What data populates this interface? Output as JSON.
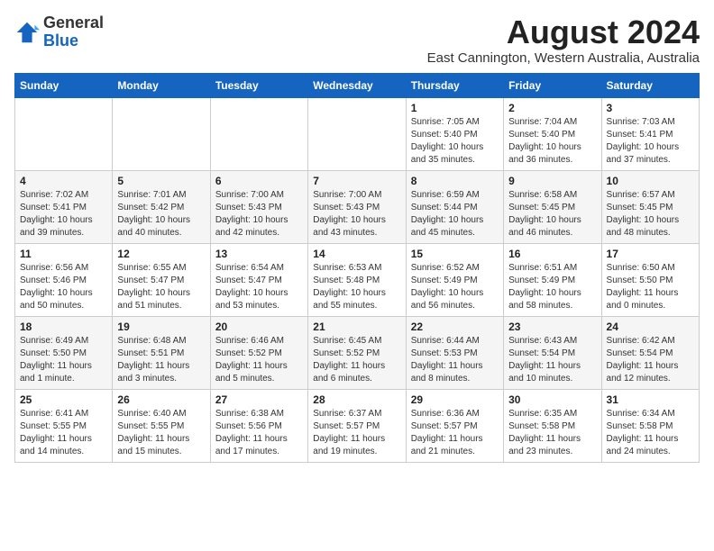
{
  "header": {
    "logo_line1": "General",
    "logo_line2": "Blue",
    "month_title": "August 2024",
    "location": "East Cannington, Western Australia, Australia"
  },
  "days_of_week": [
    "Sunday",
    "Monday",
    "Tuesday",
    "Wednesday",
    "Thursday",
    "Friday",
    "Saturday"
  ],
  "weeks": [
    [
      {
        "day": "",
        "info": ""
      },
      {
        "day": "",
        "info": ""
      },
      {
        "day": "",
        "info": ""
      },
      {
        "day": "",
        "info": ""
      },
      {
        "day": "1",
        "info": "Sunrise: 7:05 AM\nSunset: 5:40 PM\nDaylight: 10 hours\nand 35 minutes."
      },
      {
        "day": "2",
        "info": "Sunrise: 7:04 AM\nSunset: 5:40 PM\nDaylight: 10 hours\nand 36 minutes."
      },
      {
        "day": "3",
        "info": "Sunrise: 7:03 AM\nSunset: 5:41 PM\nDaylight: 10 hours\nand 37 minutes."
      }
    ],
    [
      {
        "day": "4",
        "info": "Sunrise: 7:02 AM\nSunset: 5:41 PM\nDaylight: 10 hours\nand 39 minutes."
      },
      {
        "day": "5",
        "info": "Sunrise: 7:01 AM\nSunset: 5:42 PM\nDaylight: 10 hours\nand 40 minutes."
      },
      {
        "day": "6",
        "info": "Sunrise: 7:00 AM\nSunset: 5:43 PM\nDaylight: 10 hours\nand 42 minutes."
      },
      {
        "day": "7",
        "info": "Sunrise: 7:00 AM\nSunset: 5:43 PM\nDaylight: 10 hours\nand 43 minutes."
      },
      {
        "day": "8",
        "info": "Sunrise: 6:59 AM\nSunset: 5:44 PM\nDaylight: 10 hours\nand 45 minutes."
      },
      {
        "day": "9",
        "info": "Sunrise: 6:58 AM\nSunset: 5:45 PM\nDaylight: 10 hours\nand 46 minutes."
      },
      {
        "day": "10",
        "info": "Sunrise: 6:57 AM\nSunset: 5:45 PM\nDaylight: 10 hours\nand 48 minutes."
      }
    ],
    [
      {
        "day": "11",
        "info": "Sunrise: 6:56 AM\nSunset: 5:46 PM\nDaylight: 10 hours\nand 50 minutes."
      },
      {
        "day": "12",
        "info": "Sunrise: 6:55 AM\nSunset: 5:47 PM\nDaylight: 10 hours\nand 51 minutes."
      },
      {
        "day": "13",
        "info": "Sunrise: 6:54 AM\nSunset: 5:47 PM\nDaylight: 10 hours\nand 53 minutes."
      },
      {
        "day": "14",
        "info": "Sunrise: 6:53 AM\nSunset: 5:48 PM\nDaylight: 10 hours\nand 55 minutes."
      },
      {
        "day": "15",
        "info": "Sunrise: 6:52 AM\nSunset: 5:49 PM\nDaylight: 10 hours\nand 56 minutes."
      },
      {
        "day": "16",
        "info": "Sunrise: 6:51 AM\nSunset: 5:49 PM\nDaylight: 10 hours\nand 58 minutes."
      },
      {
        "day": "17",
        "info": "Sunrise: 6:50 AM\nSunset: 5:50 PM\nDaylight: 11 hours\nand 0 minutes."
      }
    ],
    [
      {
        "day": "18",
        "info": "Sunrise: 6:49 AM\nSunset: 5:50 PM\nDaylight: 11 hours\nand 1 minute."
      },
      {
        "day": "19",
        "info": "Sunrise: 6:48 AM\nSunset: 5:51 PM\nDaylight: 11 hours\nand 3 minutes."
      },
      {
        "day": "20",
        "info": "Sunrise: 6:46 AM\nSunset: 5:52 PM\nDaylight: 11 hours\nand 5 minutes."
      },
      {
        "day": "21",
        "info": "Sunrise: 6:45 AM\nSunset: 5:52 PM\nDaylight: 11 hours\nand 6 minutes."
      },
      {
        "day": "22",
        "info": "Sunrise: 6:44 AM\nSunset: 5:53 PM\nDaylight: 11 hours\nand 8 minutes."
      },
      {
        "day": "23",
        "info": "Sunrise: 6:43 AM\nSunset: 5:54 PM\nDaylight: 11 hours\nand 10 minutes."
      },
      {
        "day": "24",
        "info": "Sunrise: 6:42 AM\nSunset: 5:54 PM\nDaylight: 11 hours\nand 12 minutes."
      }
    ],
    [
      {
        "day": "25",
        "info": "Sunrise: 6:41 AM\nSunset: 5:55 PM\nDaylight: 11 hours\nand 14 minutes."
      },
      {
        "day": "26",
        "info": "Sunrise: 6:40 AM\nSunset: 5:55 PM\nDaylight: 11 hours\nand 15 minutes."
      },
      {
        "day": "27",
        "info": "Sunrise: 6:38 AM\nSunset: 5:56 PM\nDaylight: 11 hours\nand 17 minutes."
      },
      {
        "day": "28",
        "info": "Sunrise: 6:37 AM\nSunset: 5:57 PM\nDaylight: 11 hours\nand 19 minutes."
      },
      {
        "day": "29",
        "info": "Sunrise: 6:36 AM\nSunset: 5:57 PM\nDaylight: 11 hours\nand 21 minutes."
      },
      {
        "day": "30",
        "info": "Sunrise: 6:35 AM\nSunset: 5:58 PM\nDaylight: 11 hours\nand 23 minutes."
      },
      {
        "day": "31",
        "info": "Sunrise: 6:34 AM\nSunset: 5:58 PM\nDaylight: 11 hours\nand 24 minutes."
      }
    ]
  ]
}
